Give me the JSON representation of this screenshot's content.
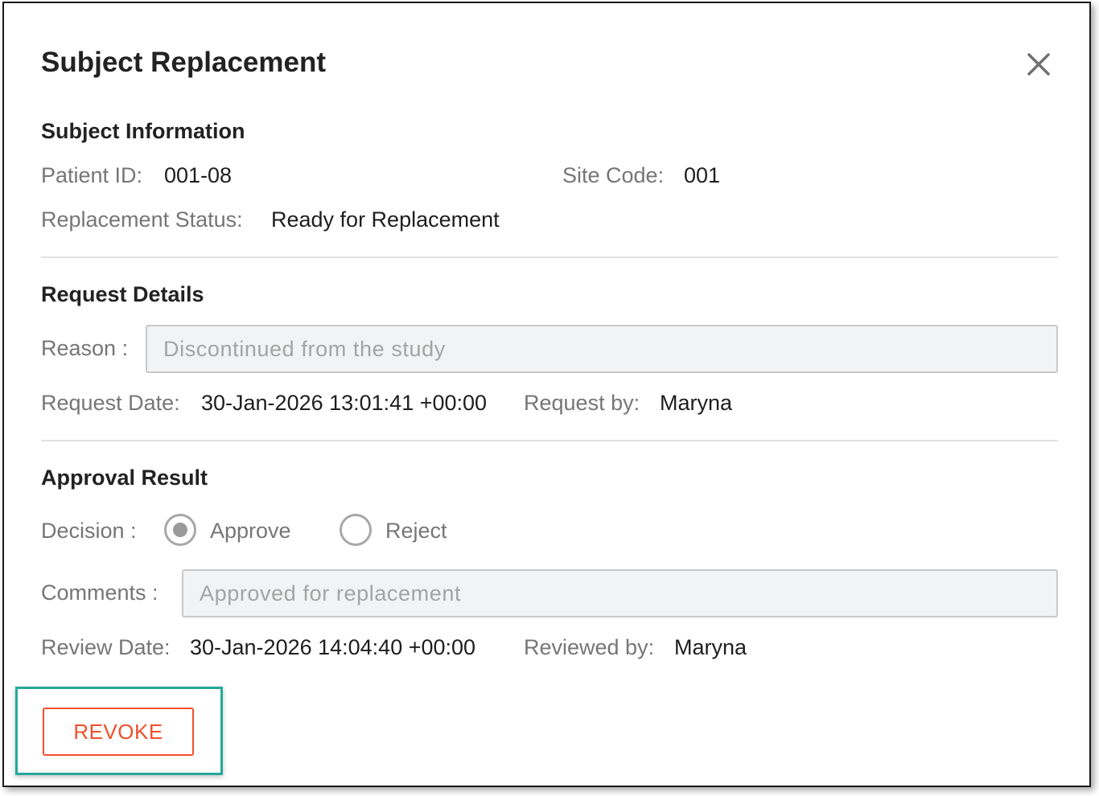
{
  "dialog": {
    "title": "Subject Replacement"
  },
  "subject_info": {
    "heading": "Subject Information",
    "patient_id_label": "Patient ID:",
    "patient_id": "001-08",
    "site_code_label": "Site Code:",
    "site_code": "001",
    "status_label": "Replacement Status:",
    "status": "Ready for Replacement"
  },
  "request": {
    "heading": "Request Details",
    "reason_label": "Reason :",
    "reason_value": "Discontinued from the study",
    "date_label": "Request Date:",
    "date": "30-Jan-2026 13:01:41 +00:00",
    "by_label": "Request by:",
    "by": "Maryna"
  },
  "approval": {
    "heading": "Approval Result",
    "decision_label": "Decision :",
    "options": [
      {
        "label": "Approve",
        "selected": true
      },
      {
        "label": "Reject",
        "selected": false
      }
    ],
    "comments_label": "Comments :",
    "comments_value": "Approved for replacement",
    "review_date_label": "Review Date:",
    "review_date": "30-Jan-2026 14:04:40 +00:00",
    "reviewed_by_label": "Reviewed by:",
    "reviewed_by": "Maryna"
  },
  "actions": {
    "revoke_label": "REVOKE"
  },
  "colors": {
    "accent": "#f0502c",
    "highlight": "#23a99a"
  },
  "icons": {
    "close": "close-icon"
  }
}
